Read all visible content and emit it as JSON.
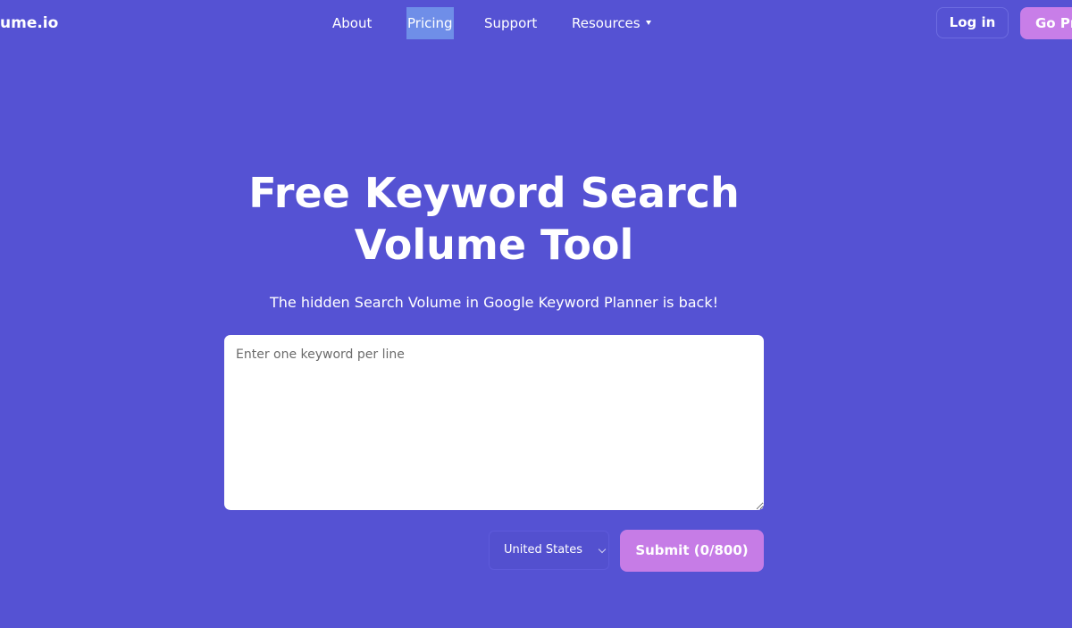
{
  "header": {
    "logo_text": "ume.io",
    "nav": {
      "about": "About",
      "pricing": "Pricing",
      "support": "Support",
      "resources": "Resources"
    },
    "login_label": "Log in",
    "go_pro_label": "Go Pr"
  },
  "hero": {
    "title_line1": "Free Keyword Search",
    "title_line2": "Volume Tool",
    "subtitle": "The hidden Search Volume in Google Keyword Planner is back!"
  },
  "form": {
    "keywords_placeholder": "Enter one keyword per line",
    "keywords_value": "",
    "country_selected": "United States",
    "submit_label": "Submit (0/800)"
  },
  "colors": {
    "background": "#5552D3",
    "accent": "#C67CE6",
    "pricing_highlight": "#6F8EE8"
  },
  "icons": {
    "resources_caret": "caret-down-icon",
    "select_chevron": "chevron-down-icon"
  }
}
